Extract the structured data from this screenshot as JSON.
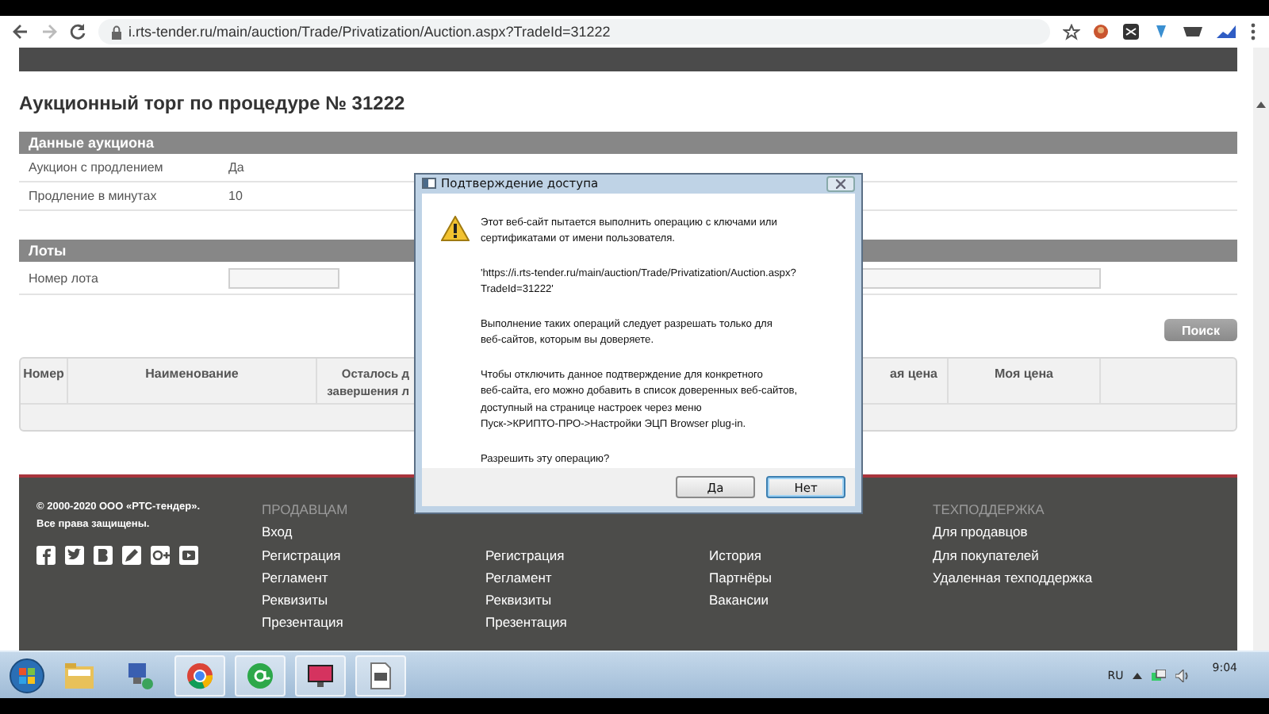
{
  "browser": {
    "url": "i.rts-tender.ru/main/auction/Trade/Privatization/Auction.aspx?TradeId=31222"
  },
  "page": {
    "title": "Аукционный торг по процедуре № 31222",
    "auction_section": {
      "heading": "Данные аукциона",
      "rows": [
        {
          "label": "Аукцион с продлением",
          "value": "Да"
        },
        {
          "label": "Продление в минутах",
          "value": "10"
        }
      ]
    },
    "lots_section": {
      "heading": "Лоты",
      "field_label": "Номер лота",
      "search_button": "Поиск",
      "table": {
        "columns": [
          "Номер",
          "Наименование",
          "Осталось д\nзавершения л",
          "ая цена",
          "Моя цена",
          ""
        ]
      }
    }
  },
  "footer": {
    "copyright": "© 2000-2020 ООО «РТС-тендер».",
    "rights": "Все права защищены.",
    "columns": [
      {
        "heading": "ПРОДАВЦАМ",
        "links": [
          "Вход",
          "Регистрация",
          "Регламент",
          "Реквизиты",
          "Презентация"
        ]
      },
      {
        "links": [
          "Регистрация",
          "Регламент",
          "Реквизиты",
          "Презентация"
        ]
      },
      {
        "links": [
          "История",
          "Партнёры",
          "Вакансии"
        ]
      },
      {
        "heading": "ТЕХПОДДЕРЖКА",
        "links": [
          "Для продавцов",
          "Для покупателей",
          "Удаленная техподдержка"
        ]
      }
    ]
  },
  "dialog": {
    "title": "Подтверждение доступа",
    "paragraphs": [
      "Этот веб-сайт пытается выполнить операцию с ключами или\nсертификатами от имени пользователя.",
      "'https://i.rts-tender.ru/main/auction/Trade/Privatization/Auction.aspx?\nTradeId=31222'",
      "Выполнение таких операций следует разрешать только для\nвеб-сайтов, которым вы доверяете.",
      "Чтобы отключить данное подтверждение для конкретного\nвеб-сайта, его можно добавить в список доверенных веб-сайтов,\nдоступный на странице настроек через меню\nПуск->КРИПТО-ПРО->Настройки ЭЦП Browser plug-in.",
      "Разрешить эту операцию?"
    ],
    "buttons": [
      {
        "label": "Да",
        "default": false
      },
      {
        "label": "Нет",
        "default": true
      }
    ]
  },
  "taskbar": {
    "language": "RU",
    "time": "9:04"
  }
}
